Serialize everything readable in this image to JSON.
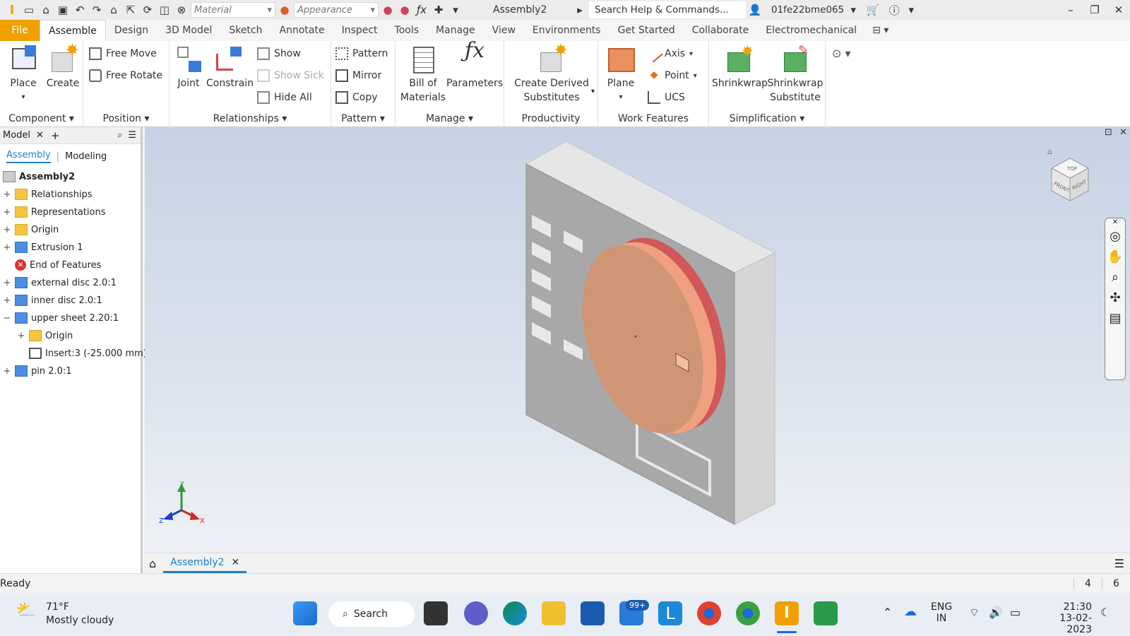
{
  "quick_access": {
    "material_placeholder": "Material",
    "appearance_placeholder": "Appearance",
    "doc_title": "Assembly2",
    "search_text": "Search Help & Commands...",
    "user": "01fe22bme065"
  },
  "tabs": [
    "File",
    "Assemble",
    "Design",
    "3D Model",
    "Sketch",
    "Annotate",
    "Inspect",
    "Tools",
    "Manage",
    "View",
    "Environments",
    "Get Started",
    "Collaborate",
    "Electromechanical"
  ],
  "ribbon": {
    "component": {
      "label": "Component",
      "place": "Place",
      "create": "Create"
    },
    "position": {
      "label": "Position",
      "free_move": "Free Move",
      "free_rotate": "Free Rotate"
    },
    "relationships": {
      "label": "Relationships",
      "joint": "Joint",
      "constrain": "Constrain",
      "show": "Show",
      "show_sick": "Show Sick",
      "hide_all": "Hide All"
    },
    "pattern": {
      "label": "Pattern",
      "pattern": "Pattern",
      "mirror": "Mirror",
      "copy": "Copy"
    },
    "manage": {
      "label": "Manage",
      "bom_l1": "Bill of",
      "bom_l2": "Materials",
      "parameters": "Parameters"
    },
    "productivity": {
      "label": "Productivity",
      "cds_l1": "Create Derived",
      "cds_l2": "Substitutes"
    },
    "work_features": {
      "label": "Work Features",
      "plane": "Plane",
      "axis": "Axis",
      "point": "Point",
      "ucs": "UCS"
    },
    "simplification": {
      "label": "Simplification",
      "shrinkwrap": "Shrinkwrap",
      "ss_l1": "Shrinkwrap",
      "ss_l2": "Substitute"
    }
  },
  "browser": {
    "header": "Model",
    "tab_assembly": "Assembly",
    "tab_modeling": "Modeling",
    "root": "Assembly2",
    "nodes": [
      {
        "label": "Relationships"
      },
      {
        "label": "Representations"
      },
      {
        "label": "Origin"
      },
      {
        "label": "Extrusion 1"
      },
      {
        "label": "End of Features"
      },
      {
        "label": "external disc 2.0:1"
      },
      {
        "label": "inner disc 2.0:1"
      },
      {
        "label": "upper sheet 2.20:1"
      },
      {
        "label": "Origin"
      },
      {
        "label": "Insert:3 (-25.000 mm)"
      },
      {
        "label": "pin 2.0:1"
      }
    ]
  },
  "viewcube": {
    "top": "TOP",
    "front": "FRONT",
    "right": "RIGHT"
  },
  "triad": {
    "x": "X",
    "y": "Y",
    "z": "Z"
  },
  "doc_tab": "Assembly2",
  "status": {
    "text": "Ready",
    "n1": "4",
    "n2": "6"
  },
  "taskbar": {
    "weather_temp": "71°F",
    "weather_desc": "Mostly cloudy",
    "search": "Search",
    "mail_badge": "99+",
    "lang1": "ENG",
    "lang2": "IN",
    "time": "21:30",
    "date": "13-02-2023"
  }
}
